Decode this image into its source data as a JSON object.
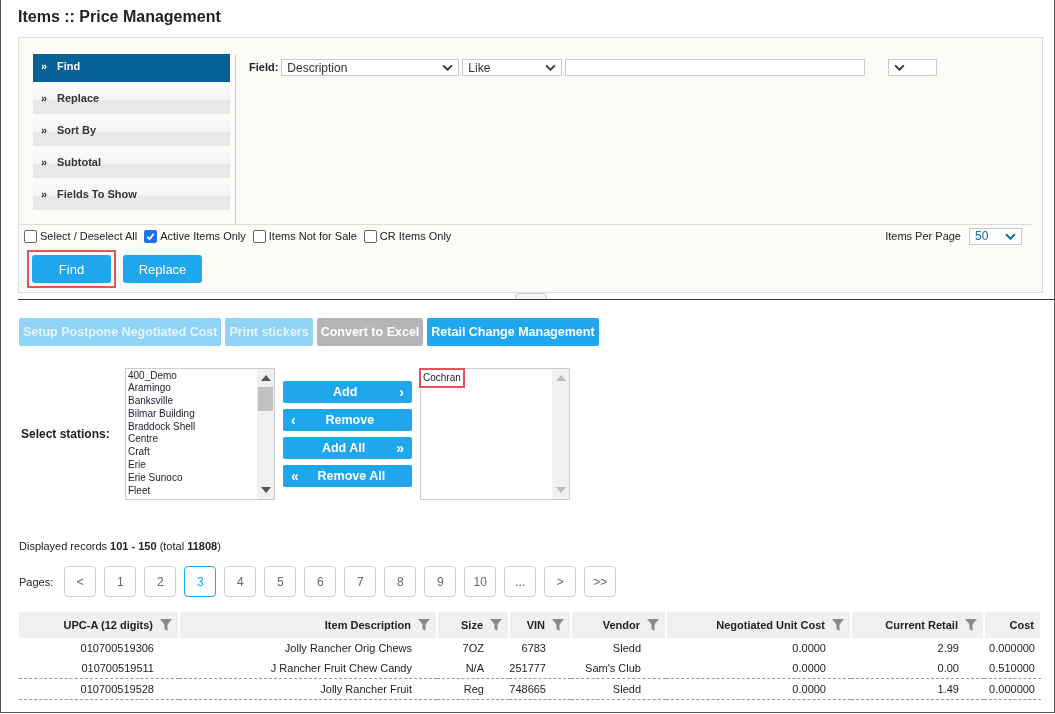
{
  "title": "Items :: Price Management",
  "menu": [
    {
      "label": "Find",
      "selected": true
    },
    {
      "label": "Replace",
      "selected": false
    },
    {
      "label": "Sort By",
      "selected": false
    },
    {
      "label": "Subtotal",
      "selected": false
    },
    {
      "label": "Fields To Show",
      "selected": false
    }
  ],
  "marker": "»",
  "field_row": {
    "label": "Field:",
    "field": "Description",
    "operator": "Like"
  },
  "options": [
    {
      "label": "Select / Deselect All",
      "checked": false
    },
    {
      "label": "Active Items Only",
      "checked": true
    },
    {
      "label": "Items Not for Sale",
      "checked": false
    },
    {
      "label": "CR Items Only",
      "checked": false
    }
  ],
  "items_per_page": {
    "label": "Items Per Page",
    "value": "50"
  },
  "panel_buttons": [
    {
      "label": "Find",
      "highlighted": true
    },
    {
      "label": "Replace",
      "highlighted": false
    }
  ],
  "actions": [
    {
      "label": "Setup Postpone Negotiated Cost",
      "kind": "disabled"
    },
    {
      "label": "Print stickers",
      "kind": "disabled"
    },
    {
      "label": "Convert to Excel",
      "kind": "neutral"
    },
    {
      "label": "Retail Change Management",
      "kind": "primary"
    }
  ],
  "stations": {
    "label": "Select stations:",
    "available": [
      "400_Demo",
      "Aramingo",
      "Banksville",
      "Bilmar Building",
      "Braddock Shell",
      "Centre",
      "Craft",
      "Erie",
      "Erie Sunoco",
      "Fleet"
    ],
    "transfer": [
      {
        "label": "Add",
        "icon_after": "›"
      },
      {
        "label": "Remove",
        "icon_before": "‹"
      },
      {
        "label": "Add All",
        "icon_after": "»"
      },
      {
        "label": "Remove All",
        "icon_before": "«"
      }
    ],
    "chosen": [
      {
        "label": "Cochran",
        "highlighted": true
      }
    ]
  },
  "records": "Displayed records **101 - 150** (total **11808**)",
  "pages": {
    "label": "Pages:",
    "items": [
      {
        "label": "<",
        "selected": false
      },
      {
        "label": "1",
        "selected": false
      },
      {
        "label": "2",
        "selected": false
      },
      {
        "label": "3",
        "selected": true
      },
      {
        "label": "4",
        "selected": false
      },
      {
        "label": "5",
        "selected": false
      },
      {
        "label": "6",
        "selected": false
      },
      {
        "label": "7",
        "selected": false
      },
      {
        "label": "8",
        "selected": false
      },
      {
        "label": "9",
        "selected": false
      },
      {
        "label": "10",
        "selected": false
      },
      {
        "label": "...",
        "selected": false
      },
      {
        "label": ">",
        "selected": false
      },
      {
        "label": ">>",
        "selected": false
      }
    ]
  },
  "table": {
    "columns": [
      {
        "label": "UPC-A (12 digits)",
        "filter": true
      },
      {
        "label": "Item Description",
        "filter": true
      },
      {
        "label": "Size",
        "filter": true
      },
      {
        "label": "VIN",
        "filter": true
      },
      {
        "label": "Vendor",
        "filter": true
      },
      {
        "label": "Negotiated Unit Cost",
        "filter": true
      },
      {
        "label": "Current Retail",
        "filter": true
      },
      {
        "label": "Cost",
        "filter": false
      }
    ],
    "rows": [
      [
        "010700519306",
        "Jolly Rancher Orig Chews",
        "7OZ",
        "6783",
        "Sledd",
        "0.0000",
        "2.99",
        "0.000000"
      ],
      [
        "010700519511",
        "J Rancher Fruit Chew Candy",
        "N/A",
        "251777",
        "Sam's Club",
        "0.0000",
        "0.00",
        "0.510000"
      ],
      [
        "010700519528",
        "Jolly Rancher Fruit",
        "Reg",
        "748665",
        "Sledd",
        "0.0000",
        "1.49",
        "0.000000"
      ]
    ]
  }
}
